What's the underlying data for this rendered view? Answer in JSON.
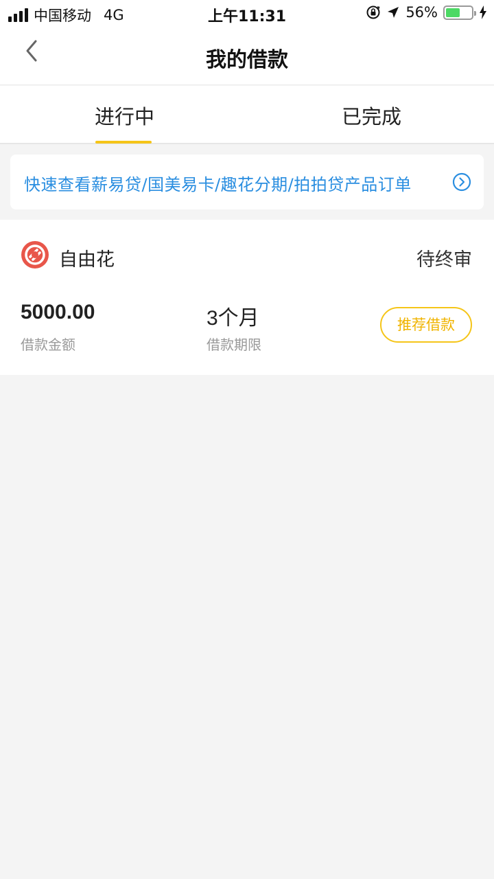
{
  "status_bar": {
    "carrier": "中国移动",
    "network": "4G",
    "time": "上午11:31",
    "battery_percent_label": "56%",
    "battery_level": 0.56,
    "icons": [
      "signal-icon",
      "orientation-lock-icon",
      "location-arrow-icon",
      "battery-icon",
      "charging-bolt-icon"
    ]
  },
  "nav": {
    "title": "我的借款",
    "back_icon": "chevron-left-icon"
  },
  "tabs": [
    {
      "label": "进行中",
      "active": true
    },
    {
      "label": "已完成",
      "active": false
    }
  ],
  "quick_link": {
    "text": "快速查看薪易贷/国美易卡/趣花分期/拍拍贷产品订单",
    "icon": "circle-chevron-right-icon",
    "color": "#2a8ee0"
  },
  "loan": {
    "product_name": "自由花",
    "product_logo": "ziyouhua-logo-icon",
    "status": "待终审",
    "amount": "5000.00",
    "amount_label": "借款金额",
    "term": "3个月",
    "term_label": "借款期限",
    "action_label": "推荐借款"
  },
  "colors": {
    "accent": "#f5c518",
    "link": "#2a8ee0",
    "logo": "#e8564a",
    "background": "#f4f4f4"
  }
}
